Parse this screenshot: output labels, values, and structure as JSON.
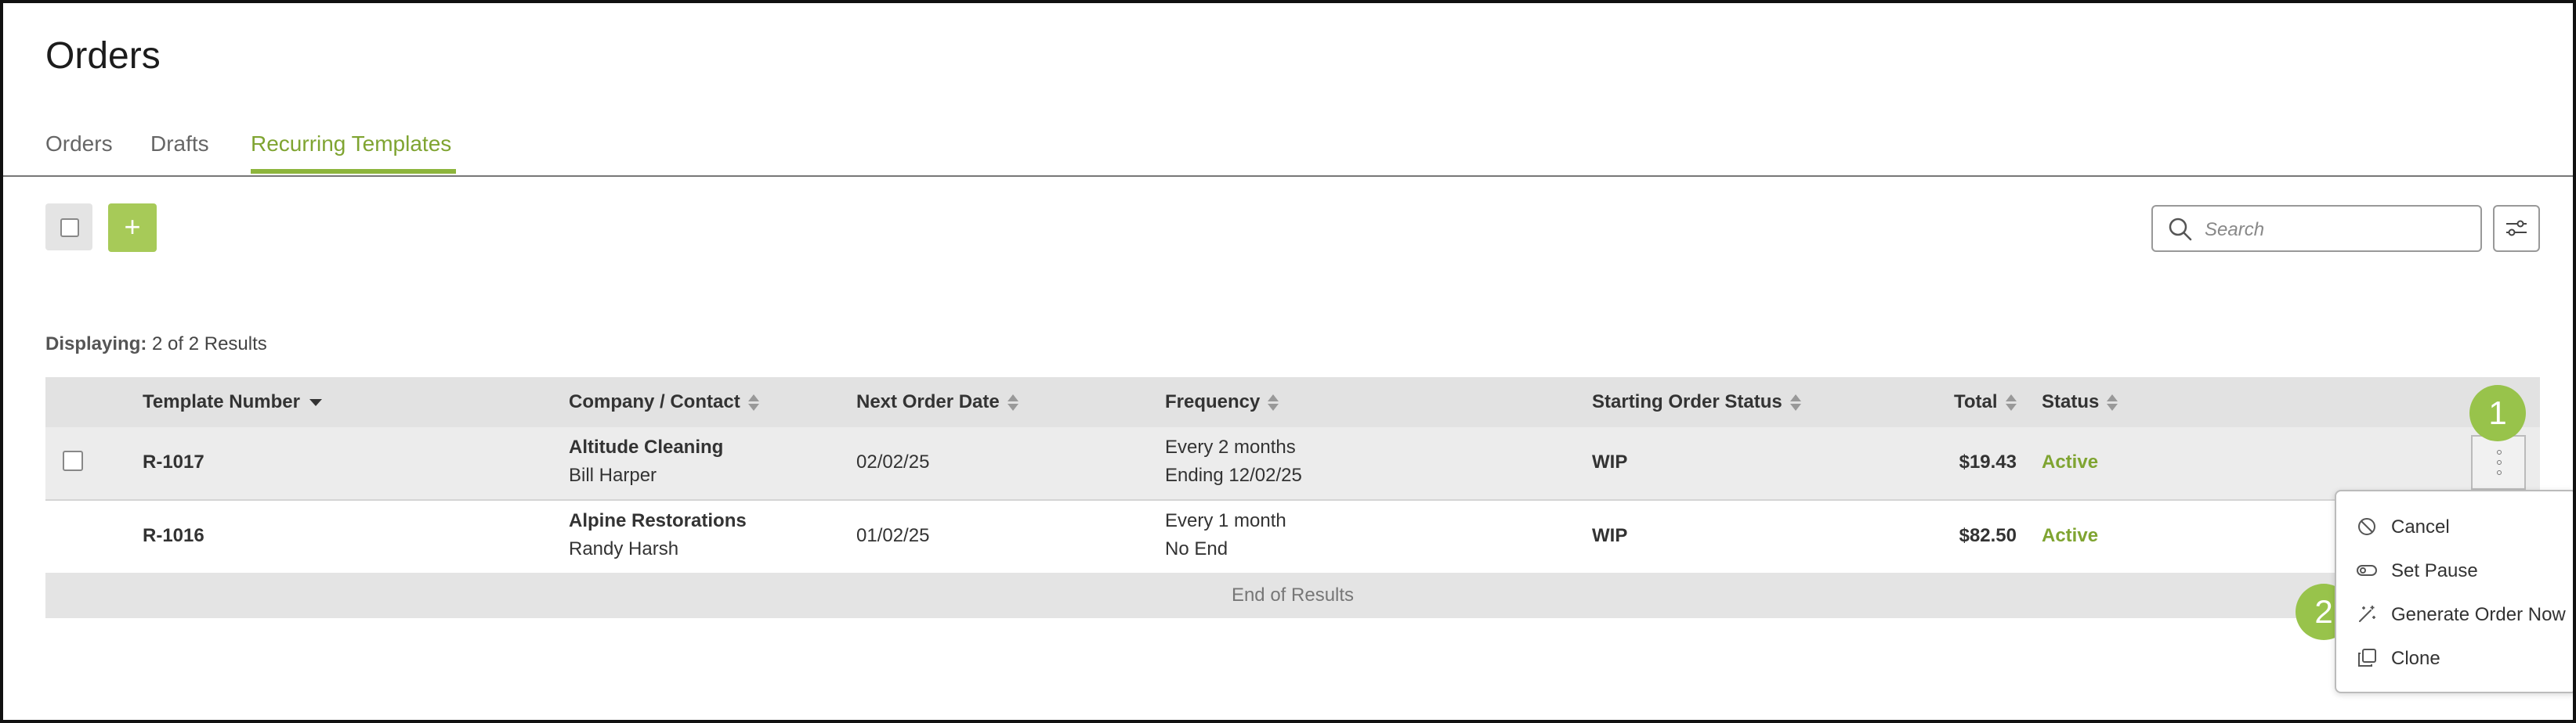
{
  "page": {
    "title": "Orders"
  },
  "tabs": [
    {
      "label": "Orders",
      "active": false
    },
    {
      "label": "Drafts",
      "active": false
    },
    {
      "label": "Recurring Templates",
      "active": true
    }
  ],
  "toolbar": {
    "add_label": "+",
    "search_placeholder": "Search",
    "search_value": ""
  },
  "results": {
    "label": "Displaying:",
    "text": "2 of 2 Results"
  },
  "table": {
    "columns": [
      "Template Number",
      "Company / Contact",
      "Next Order Date",
      "Frequency",
      "Starting Order Status",
      "Total",
      "Status"
    ],
    "rows": [
      {
        "template_number": "R-1017",
        "company": "Altitude Cleaning",
        "contact": "Bill Harper",
        "next_order_date": "02/02/25",
        "frequency": "Every 2 months",
        "frequency_end": "Ending 12/02/25",
        "starting_status": "WIP",
        "total": "$19.43",
        "status": "Active"
      },
      {
        "template_number": "R-1016",
        "company": "Alpine Restorations",
        "contact": "Randy Harsh",
        "next_order_date": "01/02/25",
        "frequency": "Every 1 month",
        "frequency_end": "No End",
        "starting_status": "WIP",
        "total": "$82.50",
        "status": "Active"
      }
    ],
    "end_text": "End of Results"
  },
  "badges": [
    "1",
    "2"
  ],
  "menu": {
    "items": [
      {
        "label": "Cancel",
        "icon": "cancel-icon"
      },
      {
        "label": "Set Pause",
        "icon": "toggle-icon"
      },
      {
        "label": "Generate Order Now",
        "icon": "magic-wand-icon"
      },
      {
        "label": "Clone",
        "icon": "clone-icon"
      }
    ]
  },
  "colors": {
    "accent": "#8db53c",
    "status_active": "#7fa431",
    "badge": "#98c34b"
  }
}
